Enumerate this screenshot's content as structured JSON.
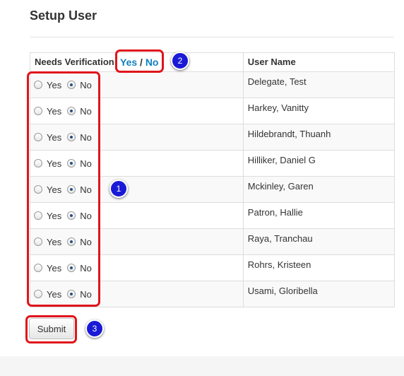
{
  "page": {
    "title": "Setup User"
  },
  "table": {
    "header": {
      "needs_verification": "Needs Verification",
      "yes_link": "Yes",
      "separator": "/",
      "no_link": "No",
      "user_name": "User Name"
    },
    "option_yes": "Yes",
    "option_no": "No",
    "rows": [
      {
        "user_name": "Delegate, Test",
        "selected": "No"
      },
      {
        "user_name": "Harkey, Vanitty",
        "selected": "No"
      },
      {
        "user_name": "Hildebrandt, Thuanh",
        "selected": "No"
      },
      {
        "user_name": "Hilliker, Daniel G",
        "selected": "No"
      },
      {
        "user_name": "Mckinley, Garen",
        "selected": "No"
      },
      {
        "user_name": "Patron, Hallie",
        "selected": "No"
      },
      {
        "user_name": "Raya, Tranchau",
        "selected": "No"
      },
      {
        "user_name": "Rohrs, Kristeen",
        "selected": "No"
      },
      {
        "user_name": "Usami, Gloribella",
        "selected": "No"
      }
    ]
  },
  "submit_label": "Submit",
  "annotations": {
    "badge_1": "1",
    "badge_2": "2",
    "badge_3": "3",
    "callout_color": "#e0141b",
    "badge_color": "#1a1ad6"
  }
}
